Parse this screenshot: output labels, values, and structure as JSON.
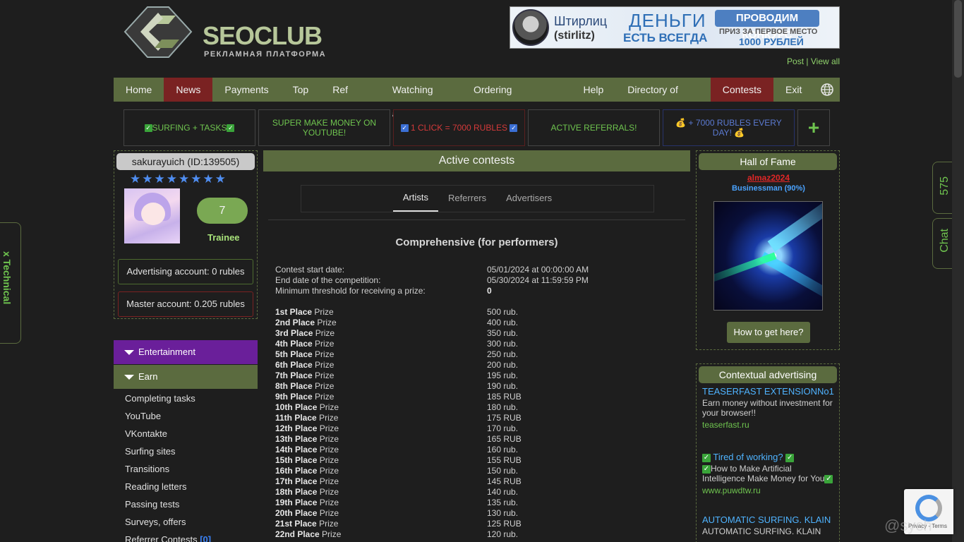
{
  "header": {
    "logo_text": "SEOCLUB",
    "logo_sub": "РЕКЛАМНАЯ ПЛАТФОРМА",
    "banner": {
      "line1": "Штирлиц",
      "line2": "(stirlitz)",
      "line3": "ДЕНЬГИ",
      "line4": "ЕСТЬ ВСЕГДА",
      "line5": "ПРОВОДИМ КОНКУРС",
      "line6": "ПРИЗ ЗА ПЕРВОЕ МЕСТО",
      "line7": "1000 РУБЛЕЙ"
    },
    "post_label": "Post",
    "view_all_label": "View all"
  },
  "nav": {
    "items": [
      "Home",
      "News",
      "Payments",
      "Top",
      "Ref Wall",
      "Watching ads",
      "Ordering advertising",
      "Help",
      "Directory of sites",
      "Contests",
      "Exit"
    ]
  },
  "promos": {
    "p1": "SURFING + TASKS",
    "p2": "SUPER MAKE MONEY ON YOUTUBE!",
    "p3": "1 CLICK = 7000 RUBLES",
    "p4": "ACTIVE REFERRALS!",
    "p5": "+ 7000 RUBLES EVERY DAY!",
    "plus": "+"
  },
  "user": {
    "name": "sakurayuich (ID:139505)",
    "stars": "★★★★★★★★",
    "level": "7",
    "rank": "Trainee",
    "advertising_account": "Advertising account: 0 rubles",
    "master_account": "Master account: 0.205 rubles"
  },
  "sidebar": {
    "entertainment": "Entertainment",
    "earn": "Earn",
    "items": [
      "Completing tasks",
      "YouTube",
      "VKontakte",
      "Surfing sites",
      "Transitions",
      "Reading letters",
      "Passing tests",
      "Surveys, offers"
    ],
    "referrer_contests": "Referrer Contests",
    "referrer_count": "[0]"
  },
  "main": {
    "title": "Active contests",
    "tabs": [
      "Artists",
      "Referrers",
      "Advertisers"
    ],
    "contest_title": "Comprehensive (for performers)",
    "info": [
      {
        "label": "Contest start date:",
        "value": "05/01/2024 at 00:00:00 AM"
      },
      {
        "label": "End date of the competition:",
        "value": "05/30/2024 at 11:59:59 PM"
      },
      {
        "label": "Minimum threshold for receiving a prize:",
        "value": "0"
      }
    ],
    "prizes": [
      {
        "place": "1st Place",
        "prize": "Prize",
        "value": "500 rub."
      },
      {
        "place": "2nd Place",
        "prize": "Prize",
        "value": "400 rub."
      },
      {
        "place": "3rd Place",
        "prize": "Prize",
        "value": "350 rub."
      },
      {
        "place": "4th Place",
        "prize": "Prize",
        "value": "300 rub."
      },
      {
        "place": "5th Place",
        "prize": "Prize",
        "value": "250 rub."
      },
      {
        "place": "6th Place",
        "prize": "Prize",
        "value": "200 rub."
      },
      {
        "place": "7th Place",
        "prize": "Prize",
        "value": "195 rub."
      },
      {
        "place": "8th Place",
        "prize": "Prize",
        "value": "190 rub."
      },
      {
        "place": "9th Place",
        "prize": "Prize",
        "value": "185 RUB"
      },
      {
        "place": "10th Place",
        "prize": "Prize",
        "value": "180 rub."
      },
      {
        "place": "11th Place",
        "prize": "Prize",
        "value": "175 RUB"
      },
      {
        "place": "12th Place",
        "prize": "Prize",
        "value": "170 rub."
      },
      {
        "place": "13th Place",
        "prize": "Prize",
        "value": "165 RUB"
      },
      {
        "place": "14th Place",
        "prize": "Prize",
        "value": "160 rub."
      },
      {
        "place": "15th Place",
        "prize": "Prize",
        "value": "155 RUB"
      },
      {
        "place": "16th Place",
        "prize": "Prize",
        "value": "150 rub."
      },
      {
        "place": "17th Place",
        "prize": "Prize",
        "value": "145 RUB"
      },
      {
        "place": "18th Place",
        "prize": "Prize",
        "value": "140 rub."
      },
      {
        "place": "19th Place",
        "prize": "Prize",
        "value": "135 rub."
      },
      {
        "place": "20th Place",
        "prize": "Prize",
        "value": "130 rub."
      },
      {
        "place": "21st Place",
        "prize": "Prize",
        "value": "125 RUB"
      },
      {
        "place": "22nd Place",
        "prize": "Prize",
        "value": "120 rub."
      }
    ]
  },
  "hall_of_fame": {
    "title": "Hall of Fame",
    "name": "almaz2024",
    "rank": "Businessman (90%)",
    "button": "How to get here?"
  },
  "context_ads": {
    "title": "Contextual advertising",
    "ads": [
      {
        "title": "TEASERFAST EXTENSIONNo1",
        "desc": "Earn money without investment for your browser!!",
        "url": "teaserfast.ru"
      },
      {
        "title": "Tired of working?",
        "desc": "How to Make Artificial Intelligence Make Money for You",
        "url": "www.puwdtw.ru"
      },
      {
        "title": "AUTOMATIC SURFING. KLAIN",
        "desc": "AUTOMATIC SURFING. KLAIN",
        "url": ""
      }
    ]
  },
  "side": {
    "technical": "x Technical",
    "count": "575",
    "chat": "Chat"
  },
  "recaptcha": {
    "text": "Privacy - Terms"
  },
  "watermark": "@sych"
}
